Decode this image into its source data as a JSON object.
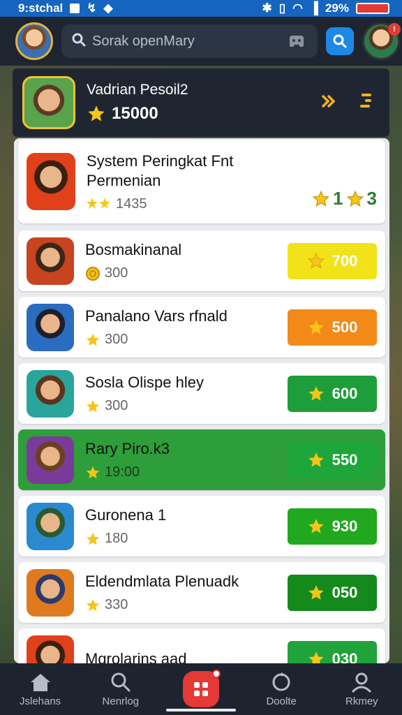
{
  "status_bar": {
    "time": "9:stchal",
    "battery": "29%"
  },
  "top_bar": {
    "search_placeholder": "Sorak openMary"
  },
  "profile": {
    "name": "Vadrian Pesoil2",
    "score": "15000"
  },
  "list": {
    "header": {
      "title": "System Peringkat Fnt Permenian",
      "sub_value": "1435",
      "score": "1",
      "score_right": "3"
    },
    "items": [
      {
        "title": "Bosmakinanal",
        "sub_value": "300",
        "points": "700",
        "color": "#f2e21a",
        "sub_icon": "coin"
      },
      {
        "title": "Panalano Vars rfnald",
        "sub_value": "300",
        "points": "500",
        "color": "#f28a1a",
        "sub_icon": "star"
      },
      {
        "title": "Sosla Olispe hley",
        "sub_value": "300",
        "points": "600",
        "color": "#1e9e3a",
        "sub_icon": "star"
      },
      {
        "title": "Rary Piro.k3",
        "sub_value": "19:00",
        "points": "550",
        "color": "#1fa63a",
        "sub_icon": "star"
      },
      {
        "title": "Guronena 1",
        "sub_value": "180",
        "points": "930",
        "color": "#21a81f",
        "sub_icon": "star"
      },
      {
        "title": "Eldendmlata Plenuadk",
        "sub_value": "330",
        "points": "050",
        "color": "#138a1b",
        "sub_icon": "star"
      },
      {
        "title": "Mgrolarins aad",
        "sub_value": "",
        "points": "030",
        "color": "#1fa33a",
        "sub_icon": "star"
      }
    ]
  },
  "bottom_nav": {
    "items": [
      {
        "label": "Jslehans",
        "icon": "home-icon"
      },
      {
        "label": "Nenrlog",
        "icon": "search-icon"
      },
      {
        "label": "",
        "icon": "grid-icon"
      },
      {
        "label": "Doolte",
        "icon": "refresh-icon"
      },
      {
        "label": "Rkmey",
        "icon": "profile-icon"
      }
    ]
  },
  "colors": {
    "status_bar": "#1565c0",
    "top_bar": "#1e2430",
    "active_row": "#2e9e3a",
    "star": "#f5c518"
  }
}
